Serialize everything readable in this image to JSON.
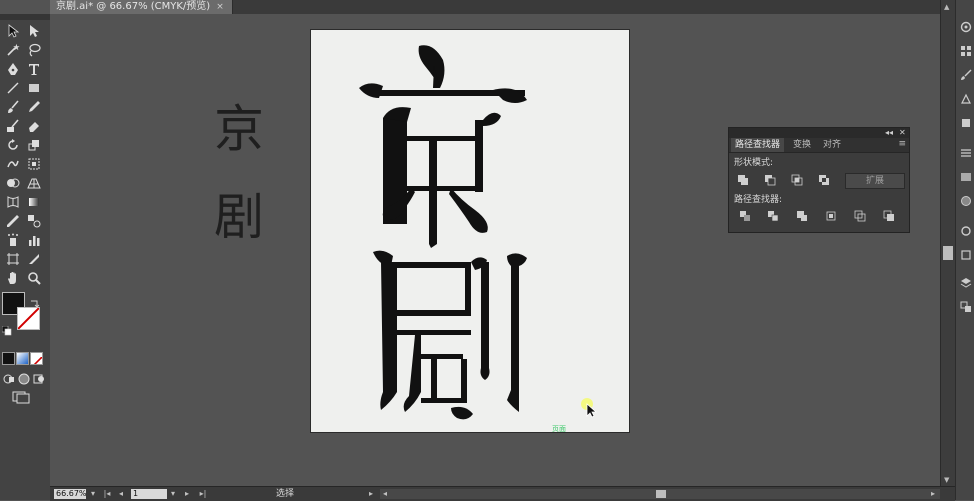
{
  "document_tab": {
    "title": "京剧.ai* @ 66.67% (CMYK/预览)",
    "close": "×"
  },
  "artwork": {
    "label_jing": "京",
    "label_ju": "剧",
    "stylized_text": "京剧"
  },
  "cursor_hint": "页面",
  "pathfinder": {
    "collapse": "◂◂",
    "close": "✕",
    "menu": "≡",
    "tabs": [
      "路径查找器",
      "变换",
      "对齐"
    ],
    "shape_modes_label": "形状模式:",
    "pathfinders_label": "路径查找器:",
    "expand_label": "扩展",
    "shape_mode_icons": [
      "unite-icon",
      "minus-front-icon",
      "intersect-icon",
      "exclude-icon"
    ],
    "pathfinder_icons": [
      "divide-icon",
      "trim-icon",
      "merge-icon",
      "crop-icon",
      "outline-icon",
      "minus-back-icon"
    ]
  },
  "statusbar": {
    "zoom": "66.67%",
    "page": "1",
    "tool_name": "选择",
    "zoom_arrow": "▾",
    "first_page": "|◂",
    "prev_page": "◂",
    "page_arrow": "▾",
    "next_page": "▸",
    "last_page": "▸|",
    "status_arrow": "▸",
    "scroll_left": "◂",
    "scroll_right": "▸"
  },
  "scrollbar": {
    "up": "▲",
    "down": "▼"
  },
  "colors": {
    "fill": "#111111",
    "stroke": "none",
    "ui_bg": "#535353",
    "artboard": "#eff0ee",
    "hint": "#3ec96b"
  }
}
